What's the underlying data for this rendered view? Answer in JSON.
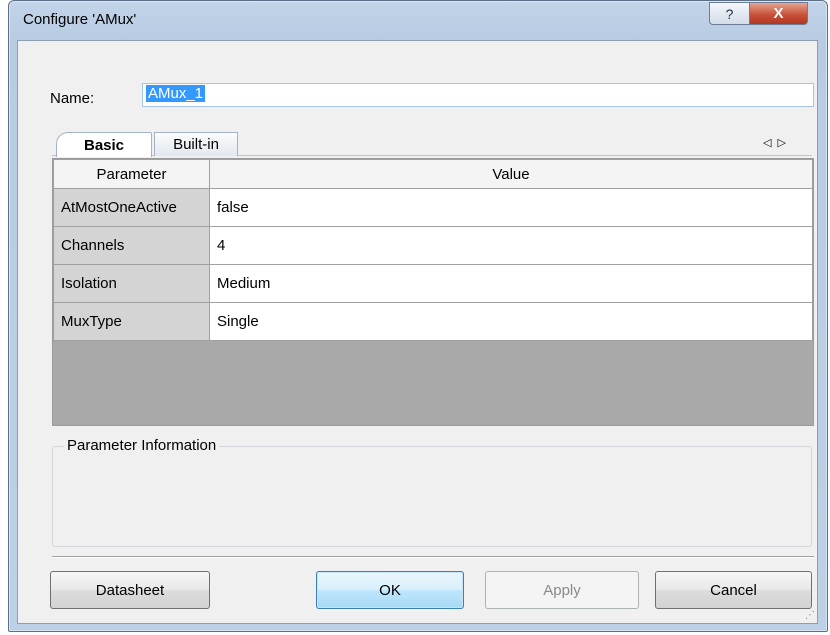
{
  "window": {
    "title": "Configure 'AMux'",
    "help_glyph": "?",
    "close_glyph": "X"
  },
  "name_field": {
    "label": "Name:",
    "value": "AMux_1"
  },
  "tabs": [
    {
      "label": "Basic",
      "active": true
    },
    {
      "label": "Built-in",
      "active": false
    }
  ],
  "tab_scroll": {
    "left": "◁",
    "right": "▷"
  },
  "grid": {
    "headers": {
      "parameter": "Parameter",
      "value": "Value"
    },
    "rows": [
      {
        "name": "AtMostOneActive",
        "value": "false"
      },
      {
        "name": "Channels",
        "value": "4"
      },
      {
        "name": "Isolation",
        "value": "Medium"
      },
      {
        "name": "MuxType",
        "value": "Single"
      }
    ]
  },
  "info": {
    "label": "Parameter Information"
  },
  "buttons": {
    "datasheet": "Datasheet",
    "ok": "OK",
    "apply": "Apply",
    "cancel": "Cancel"
  },
  "colors": {
    "selection": "#3399ff",
    "close_button": "#c75239",
    "grid_background": "#a9a9a9"
  }
}
